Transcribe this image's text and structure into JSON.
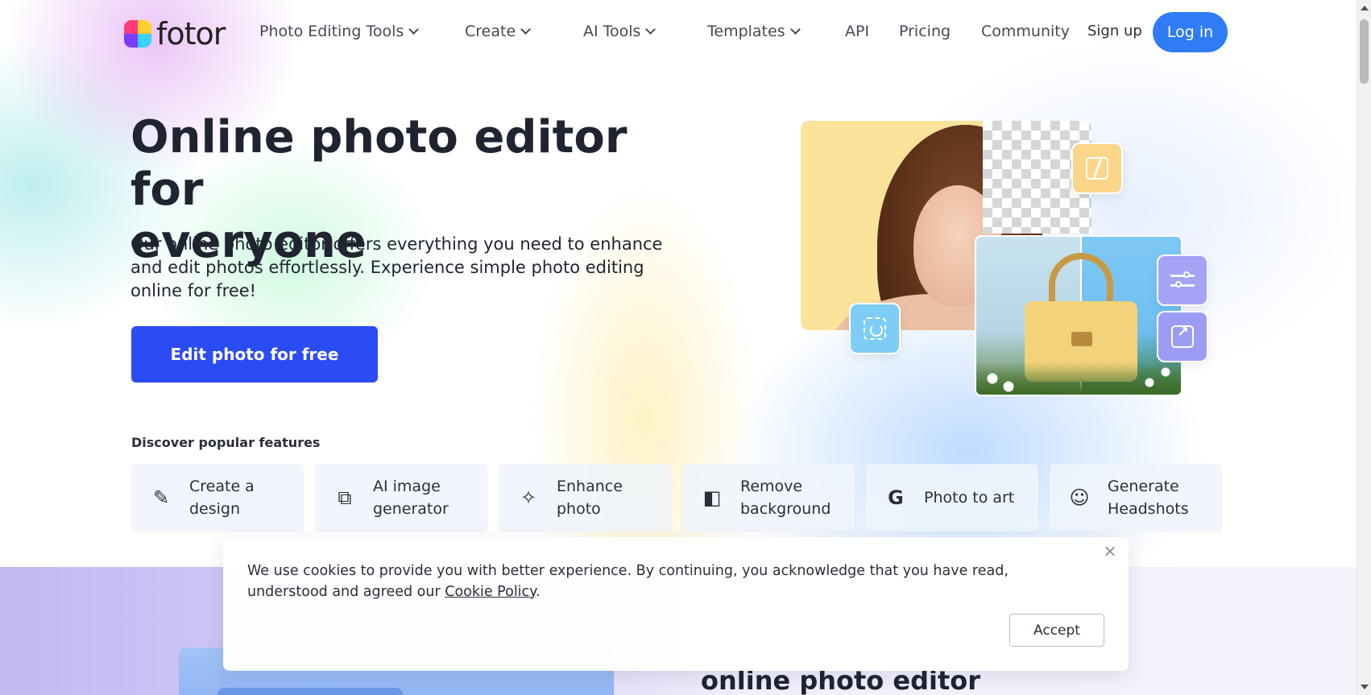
{
  "brand": {
    "name": "fotor"
  },
  "nav": {
    "items": [
      {
        "label": "Photo Editing Tools",
        "dropdown": true
      },
      {
        "label": "Create",
        "dropdown": true
      },
      {
        "label": "AI Tools",
        "dropdown": true
      },
      {
        "label": "Templates",
        "dropdown": true
      },
      {
        "label": "API",
        "dropdown": false
      },
      {
        "label": "Pricing",
        "dropdown": false
      },
      {
        "label": "Community",
        "dropdown": false
      }
    ],
    "signup": "Sign up",
    "login": "Log in"
  },
  "hero": {
    "title_line1": "Online photo editor for",
    "title_line2": "everyone",
    "subtitle": "Our online photo editor offers everything you need to enhance and edit photos effortlessly. Experience simple photo editing online for free!",
    "cta": "Edit photo for free"
  },
  "features": {
    "heading": "Discover popular features",
    "items": [
      {
        "line1": "Create a",
        "line2": "design",
        "icon": "pencil-ruler-icon"
      },
      {
        "line1": "AI image",
        "line2": "generator",
        "icon": "ai-image-icon"
      },
      {
        "line1": "Enhance",
        "line2": "photo",
        "icon": "magic-wand-icon"
      },
      {
        "line1": "Remove",
        "line2": "background",
        "icon": "remove-bg-icon"
      },
      {
        "line1": "Photo to art",
        "line2": "",
        "icon": "photo-to-art-icon"
      },
      {
        "line1": "Generate",
        "line2": "Headshots",
        "icon": "headshot-icon"
      }
    ]
  },
  "lower": {
    "title": "online photo editor"
  },
  "cookie": {
    "text_before": "We use cookies to provide you with better experience. By continuing, you acknowledge that you have read, understood and agreed our ",
    "link": "Cookie Policy",
    "text_after": ".",
    "accept": "Accept",
    "close": "×"
  },
  "colors": {
    "primary_blue": "#2f7cf6",
    "cta_blue": "#2b4cf5",
    "text_dark": "#1f2430"
  }
}
